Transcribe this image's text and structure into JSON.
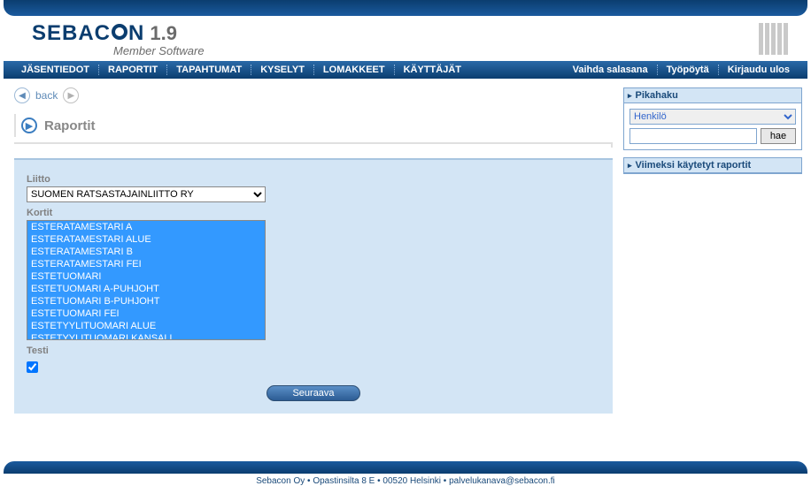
{
  "app": {
    "name": "SEBACON",
    "version": "1.9",
    "subtitle": "Member Software"
  },
  "nav": {
    "items": [
      {
        "label": "JÄSENTIEDOT"
      },
      {
        "label": "RAPORTIT"
      },
      {
        "label": "TAPAHTUMAT"
      },
      {
        "label": "KYSELYT"
      },
      {
        "label": "LOMAKKEET"
      },
      {
        "label": "KÄYTTÄJÄT"
      }
    ],
    "right": [
      {
        "label": "Vaihda salasana"
      },
      {
        "label": "Työpöytä"
      },
      {
        "label": "Kirjaudu ulos"
      }
    ]
  },
  "back_label": "back",
  "page_title": "Raportit",
  "form": {
    "liitto_label": "Liitto",
    "liitto_value": "SUOMEN RATSASTAJAINLIITTO RY",
    "kortit_label": "Kortit",
    "kortit_options": [
      "ESTERATAMESTARI A",
      "ESTERATAMESTARI ALUE",
      "ESTERATAMESTARI B",
      "ESTERATAMESTARI FEI",
      "ESTETUOMARI",
      "ESTETUOMARI A-PUHJOHT",
      "ESTETUOMARI B-PUHJOHT",
      "ESTETUOMARI FEI",
      "ESTETYYLITUOMARI ALUE",
      "ESTETYYLITUOMARI KANSALL."
    ],
    "testi_label": "Testi",
    "testi_checked": true,
    "submit": "Seuraava"
  },
  "quicksearch": {
    "title": "Pikahaku",
    "type": "Henkilö",
    "button": "hae"
  },
  "recent": {
    "title": "Viimeksi käytetyt raportit"
  },
  "footer": {
    "company": "Sebacon Oy",
    "address": "Opastinsilta 8 E",
    "city": "00520 Helsinki",
    "email": "palvelukanava@sebacon.fi"
  }
}
